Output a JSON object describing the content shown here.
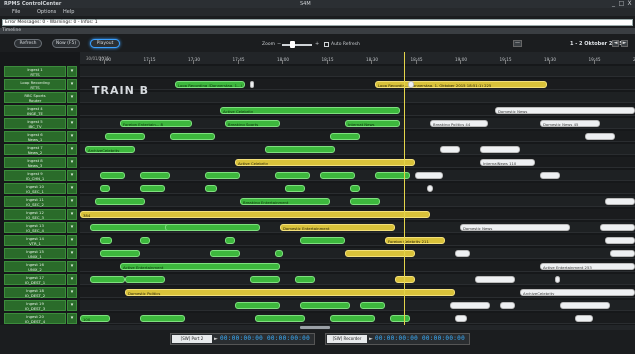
{
  "window": {
    "app_title": "RPMS ControlCenter",
    "center_title": "S4M",
    "buttons": [
      "_",
      "□",
      "X"
    ]
  },
  "menu": [
    "File",
    "Options",
    "Help"
  ],
  "error_bar": "Error Messages: 0 - Warnings: 0 - Infos: 1",
  "timeline_header": "Timeline",
  "toolbar": {
    "refresh": "Refresh",
    "now": "Now (F5)",
    "playout": "Playout",
    "zoom_label": "Zoom",
    "zoom_minus": "−",
    "zoom_plus": "+",
    "zoom_level": 0.35,
    "auto_refresh_label": "Auto Refresh",
    "range": "1 - 2 Oktober 2015",
    "nav_prev": "◄",
    "nav_next": "►"
  },
  "ruler": {
    "date": "30/01/2015",
    "times": [
      "17:00",
      "17:15",
      "17:30",
      "17:45",
      "18:00",
      "18:15",
      "18:30",
      "18:45",
      "19:00",
      "19:15",
      "19:30",
      "19:45",
      "20:00"
    ]
  },
  "group_label": "TRAIN B",
  "rows": [
    {
      "label": "Ingest 1\nRTTS"
    },
    {
      "label": "Loop Recording\nRTTS"
    },
    {
      "label": "RBC Sports\nRouter"
    },
    {
      "label": "Ingest 4\nINGE_TE"
    },
    {
      "label": "Ingest 5\nIBC_TV"
    },
    {
      "label": "Ingest 6\nNews_1"
    },
    {
      "label": "Ingest 7\nNews_2"
    },
    {
      "label": "Ingest 8\nNews_3"
    },
    {
      "label": "Ingest 9\nIO_CHN_1"
    },
    {
      "label": "Ingest 10\nIO_SEC_1"
    },
    {
      "label": "Ingest 11\nIO_SEC_2"
    },
    {
      "label": "Ingest 12\nIO_SEC_3"
    },
    {
      "label": "Ingest 13\nIO_SEC_4"
    },
    {
      "label": "Ingest 14\nVTR_1"
    },
    {
      "label": "Ingest 15\nUNIX_1"
    },
    {
      "label": "Ingest 16\nUNIX_2"
    },
    {
      "label": "Ingest 17\nIO_DEST_1"
    },
    {
      "label": "Ingest 18\nIO_DEST_2"
    },
    {
      "label": "Ingest 19\nIO_DEST_3"
    },
    {
      "label": "Ingest 20\nIO_DEST_4"
    }
  ],
  "segments": {
    "loop_left": "Loop Recording (Donnerstag, 1...) 224",
    "loop_right": "Loop Recordin...(Donnerstag, 1. Oktober 2015 18:51:1)   225",
    "active_celebrity": "Active Celebrity",
    "domestic_news": "Domestic News",
    "foreign_entertain": "Foreign Entertain... 8",
    "breaking_sports": "Breaking Sports",
    "internat_news": "Internat News",
    "breaking_politics": "Breaking Politics   44",
    "domestic_news2": "Domestic News   45",
    "archive_celebrity": "ArchiveCelebrity",
    "active_celeb_long": "Active Celebrity",
    "internal_news": "InternalNews   110",
    "domestic_ent": "Domestic Entertainment",
    "foreign_celeb": "Foreign Celebrity 211",
    "domestic_politics": "Domestic Politics",
    "archive_celeb2": "ArchiveCelebrity",
    "active_entertainment": "Active Entertainment",
    "archive_ent": "Active Entertainment   253",
    "breaking_ent": "Breaking Entertainment",
    "n384": "384",
    "n100": "100"
  },
  "bottom": {
    "panel1_label": "[SW] Port 2",
    "panel1_tc": "00:00:00:00 00:00:00:00",
    "panel2_label": "[SW] Recorder",
    "panel2_tc": "00:00:00:00 00:00:00:00"
  },
  "colors": {
    "green_row": "#2a6b2a",
    "segment_green": "#3db83d",
    "segment_yellow": "#d9c23a",
    "playhead": "#e4d44a",
    "timecode": "#3ab0ff"
  }
}
